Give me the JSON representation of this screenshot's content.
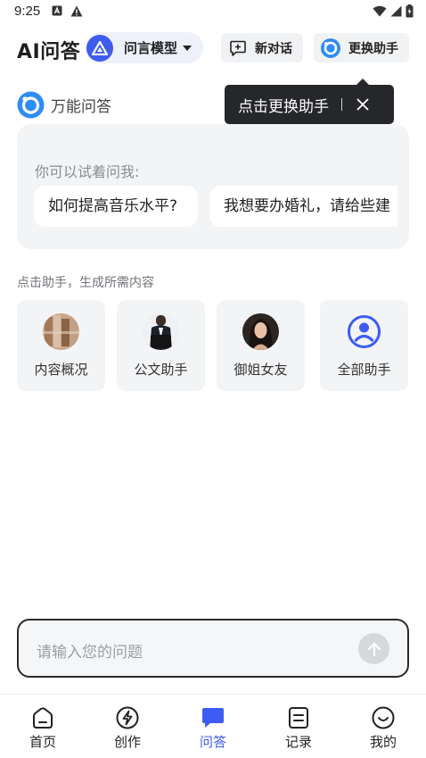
{
  "status_bar": {
    "time": "9:25"
  },
  "header": {
    "title": "AI问答",
    "model_label": "问言模型",
    "new_chat_label": "新对话",
    "switch_assistant_label": "更换助手"
  },
  "tooltip": {
    "text": "点击更换助手"
  },
  "assistant": {
    "name": "万能问答"
  },
  "suggestions": {
    "hint": "你可以试着问我:",
    "chips": [
      "如何提高音乐水平?",
      "我想要办婚礼，请给些建"
    ]
  },
  "helpers": {
    "title": "点击助手，生成所需内容",
    "items": [
      {
        "label": "内容概况"
      },
      {
        "label": "公文助手"
      },
      {
        "label": "御姐女友"
      },
      {
        "label": "全部助手"
      }
    ]
  },
  "input": {
    "placeholder": "请输入您的问题"
  },
  "nav": {
    "items": [
      {
        "label": "首页",
        "icon": "home-icon"
      },
      {
        "label": "创作",
        "icon": "create-icon"
      },
      {
        "label": "问答",
        "icon": "chat-icon"
      },
      {
        "label": "记录",
        "icon": "records-icon"
      },
      {
        "label": "我的",
        "icon": "profile-icon"
      }
    ],
    "active": "问答"
  },
  "colors": {
    "accent": "#3d5cf5",
    "tooltip_bg": "#26272b",
    "card_bg": "#f3f4f6"
  }
}
